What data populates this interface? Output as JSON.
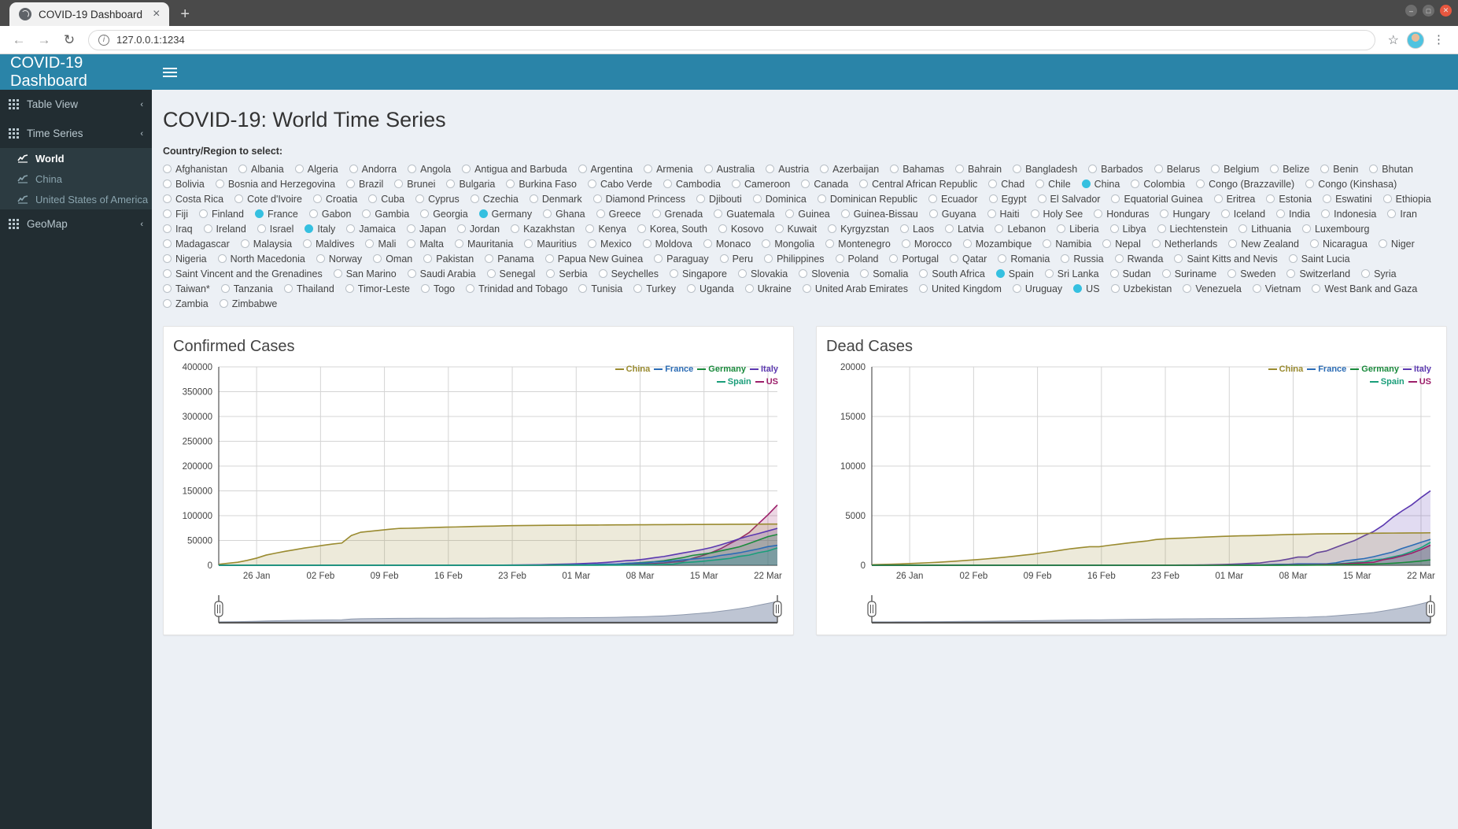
{
  "browser": {
    "tab_title": "COVID-19 Dashboard",
    "tab_close": "×",
    "new_tab": "+",
    "back": "←",
    "forward": "→",
    "reload": "↻",
    "info_icon": "i",
    "url": "127.0.0.1:1234",
    "star": "☆",
    "kebab": "⋮",
    "minimize": "–",
    "maximize": "□",
    "close": "✕"
  },
  "sidebar": {
    "brand": "COVID-19 Dashboard",
    "items": [
      {
        "label": "Table View",
        "chevron": "‹"
      },
      {
        "label": "Time Series",
        "chevron": "‹"
      }
    ],
    "sub_items": [
      {
        "label": "World",
        "active": true
      },
      {
        "label": "China",
        "active": false
      },
      {
        "label": "United States of America",
        "active": false
      }
    ],
    "geomap": {
      "label": "GeoMap",
      "chevron": "‹"
    }
  },
  "main": {
    "page_title": "COVID-19: World Time Series",
    "select_label": "Country/Region to select:",
    "selected_countries": [
      "China",
      "France",
      "Germany",
      "Italy",
      "Spain",
      "US"
    ],
    "countries": [
      "Afghanistan",
      "Albania",
      "Algeria",
      "Andorra",
      "Angola",
      "Antigua and Barbuda",
      "Argentina",
      "Armenia",
      "Australia",
      "Austria",
      "Azerbaijan",
      "Bahamas",
      "Bahrain",
      "Bangladesh",
      "Barbados",
      "Belarus",
      "Belgium",
      "Belize",
      "Benin",
      "Bhutan",
      "Bolivia",
      "Bosnia and Herzegovina",
      "Brazil",
      "Brunei",
      "Bulgaria",
      "Burkina Faso",
      "Cabo Verde",
      "Cambodia",
      "Cameroon",
      "Canada",
      "Central African Republic",
      "Chad",
      "Chile",
      "China",
      "Colombia",
      "Congo (Brazzaville)",
      "Congo (Kinshasa)",
      "Costa Rica",
      "Cote d'Ivoire",
      "Croatia",
      "Cuba",
      "Cyprus",
      "Czechia",
      "Denmark",
      "Diamond Princess",
      "Djibouti",
      "Dominica",
      "Dominican Republic",
      "Ecuador",
      "Egypt",
      "El Salvador",
      "Equatorial Guinea",
      "Eritrea",
      "Estonia",
      "Eswatini",
      "Ethiopia",
      "Fiji",
      "Finland",
      "France",
      "Gabon",
      "Gambia",
      "Georgia",
      "Germany",
      "Ghana",
      "Greece",
      "Grenada",
      "Guatemala",
      "Guinea",
      "Guinea-Bissau",
      "Guyana",
      "Haiti",
      "Holy See",
      "Honduras",
      "Hungary",
      "Iceland",
      "India",
      "Indonesia",
      "Iran",
      "Iraq",
      "Ireland",
      "Israel",
      "Italy",
      "Jamaica",
      "Japan",
      "Jordan",
      "Kazakhstan",
      "Kenya",
      "Korea, South",
      "Kosovo",
      "Kuwait",
      "Kyrgyzstan",
      "Laos",
      "Latvia",
      "Lebanon",
      "Liberia",
      "Libya",
      "Liechtenstein",
      "Lithuania",
      "Luxembourg",
      "Madagascar",
      "Malaysia",
      "Maldives",
      "Mali",
      "Malta",
      "Mauritania",
      "Mauritius",
      "Mexico",
      "Moldova",
      "Monaco",
      "Mongolia",
      "Montenegro",
      "Morocco",
      "Mozambique",
      "Namibia",
      "Nepal",
      "Netherlands",
      "New Zealand",
      "Nicaragua",
      "Niger",
      "Nigeria",
      "North Macedonia",
      "Norway",
      "Oman",
      "Pakistan",
      "Panama",
      "Papua New Guinea",
      "Paraguay",
      "Peru",
      "Philippines",
      "Poland",
      "Portugal",
      "Qatar",
      "Romania",
      "Russia",
      "Rwanda",
      "Saint Kitts and Nevis",
      "Saint Lucia",
      "Saint Vincent and the Grenadines",
      "San Marino",
      "Saudi Arabia",
      "Senegal",
      "Serbia",
      "Seychelles",
      "Singapore",
      "Slovakia",
      "Slovenia",
      "Somalia",
      "South Africa",
      "Spain",
      "Sri Lanka",
      "Sudan",
      "Suriname",
      "Sweden",
      "Switzerland",
      "Syria",
      "Taiwan*",
      "Tanzania",
      "Thailand",
      "Timor-Leste",
      "Togo",
      "Trinidad and Tobago",
      "Tunisia",
      "Turkey",
      "Uganda",
      "Ukraine",
      "United Arab Emirates",
      "United Kingdom",
      "Uruguay",
      "US",
      "Uzbekistan",
      "Venezuela",
      "Vietnam",
      "West Bank and Gaza",
      "Zambia",
      "Zimbabwe"
    ]
  },
  "chart_data": [
    {
      "type": "area",
      "title": "Confirmed Cases",
      "xlabel": "",
      "ylabel": "",
      "ylim": [
        0,
        400000
      ],
      "yticks": [
        0,
        50000,
        100000,
        150000,
        200000,
        250000,
        300000,
        350000,
        400000
      ],
      "xticks": [
        "26 Jan",
        "02 Feb",
        "09 Feb",
        "16 Feb",
        "23 Feb",
        "01 Mar",
        "08 Mar",
        "15 Mar",
        "22 Mar"
      ],
      "grid": true,
      "legend_position": "top-right",
      "series": [
        {
          "name": "China",
          "color": "#9a8b30",
          "values": [
            2000,
            4000,
            6000,
            9800,
            14400,
            20500,
            24400,
            28100,
            31200,
            34600,
            37300,
            40200,
            42700,
            44800,
            59900,
            66600,
            68600,
            70600,
            72500,
            74200,
            74600,
            75100,
            75700,
            76300,
            76900,
            77200,
            77700,
            78200,
            78600,
            78900,
            79400,
            79900,
            80100,
            80300,
            80400,
            80600,
            80700,
            80800,
            80900,
            81000,
            81100,
            81300,
            81400,
            81500,
            81600,
            81700,
            81800,
            81900,
            82000,
            82100,
            82200,
            82300,
            82400,
            82500,
            82600,
            82700,
            82800,
            82900,
            83000,
            83100
          ]
        },
        {
          "name": "France",
          "color": "#2b6cb5",
          "values": [
            3,
            4,
            5,
            5,
            6,
            6,
            6,
            6,
            11,
            11,
            11,
            11,
            11,
            11,
            11,
            11,
            11,
            11,
            12,
            12,
            12,
            12,
            12,
            12,
            12,
            12,
            14,
            18,
            38,
            57,
            100,
            130,
            191,
            212,
            285,
            377,
            653,
            949,
            1126,
            1209,
            1784,
            2281,
            2281,
            3661,
            4469,
            4499,
            6633,
            7652,
            9043,
            10871,
            12612,
            14282,
            16018,
            19856,
            22304,
            25233,
            29155,
            32964,
            37575,
            40174
          ]
        },
        {
          "name": "Germany",
          "color": "#1a8a3c",
          "values": [
            0,
            0,
            0,
            0,
            4,
            4,
            4,
            5,
            8,
            10,
            12,
            12,
            12,
            13,
            13,
            14,
            14,
            16,
            16,
            16,
            16,
            16,
            16,
            16,
            16,
            16,
            17,
            27,
            46,
            48,
            79,
            130,
            159,
            196,
            262,
            482,
            670,
            799,
            1040,
            1176,
            1457,
            1908,
            2078,
            3675,
            4585,
            5795,
            7272,
            9257,
            12327,
            15320,
            19848,
            22213,
            24873,
            29056,
            32986,
            37323,
            43938,
            50871,
            57695,
            62095
          ]
        },
        {
          "name": "Italy",
          "color": "#5b38b0",
          "values": [
            0,
            0,
            0,
            0,
            0,
            0,
            0,
            2,
            2,
            2,
            2,
            2,
            3,
            3,
            3,
            3,
            3,
            3,
            3,
            3,
            3,
            3,
            3,
            3,
            3,
            3,
            20,
            62,
            155,
            229,
            322,
            453,
            655,
            888,
            1128,
            1694,
            2036,
            2502,
            3089,
            3858,
            4636,
            5883,
            7375,
            9172,
            10149,
            12462,
            15113,
            17660,
            21157,
            24747,
            27980,
            31506,
            35713,
            41035,
            47021,
            53578,
            59138,
            63927,
            69176,
            74386
          ]
        },
        {
          "name": "Spain",
          "color": "#1a9e7a",
          "values": [
            0,
            0,
            0,
            0,
            0,
            0,
            0,
            0,
            0,
            1,
            1,
            1,
            1,
            1,
            1,
            1,
            1,
            1,
            2,
            2,
            2,
            2,
            2,
            2,
            2,
            2,
            2,
            2,
            2,
            2,
            2,
            2,
            3,
            5,
            10,
            25,
            32,
            45,
            84,
            120,
            165,
            222,
            259,
            400,
            500,
            673,
            1073,
            1695,
            2277,
            5232,
            6391,
            7798,
            9942,
            11748,
            13910,
            17963,
            20410,
            25374,
            28768,
            35136
          ]
        },
        {
          "name": "US",
          "color": "#9c1f6a",
          "values": [
            1,
            1,
            2,
            2,
            5,
            5,
            5,
            5,
            5,
            7,
            8,
            8,
            11,
            11,
            11,
            11,
            12,
            12,
            12,
            12,
            13,
            13,
            13,
            13,
            15,
            15,
            15,
            35,
            53,
            59,
            60,
            68,
            74,
            98,
            118,
            149,
            217,
            262,
            402,
            518,
            583,
            959,
            1281,
            1663,
            2179,
            2727,
            3499,
            4632,
            6421,
            7783,
            13677,
            19100,
            25489,
            33276,
            43847,
            53740,
            65778,
            83836,
            101657,
            121478
          ]
        }
      ]
    },
    {
      "type": "area",
      "title": "Dead Cases",
      "xlabel": "",
      "ylabel": "",
      "ylim": [
        0,
        20000
      ],
      "yticks": [
        0,
        5000,
        10000,
        15000,
        20000
      ],
      "xticks": [
        "26 Jan",
        "02 Feb",
        "09 Feb",
        "16 Feb",
        "23 Feb",
        "01 Mar",
        "08 Mar",
        "15 Mar",
        "22 Mar"
      ],
      "grid": true,
      "legend_position": "top-right",
      "series": [
        {
          "name": "China",
          "color": "#9a8b30",
          "values": [
            56,
            81,
            106,
            132,
            170,
            213,
            259,
            304,
            361,
            425,
            490,
            563,
            636,
            722,
            811,
            908,
            1016,
            1113,
            1259,
            1380,
            1523,
            1665,
            1770,
            1868,
            1868,
            2004,
            2118,
            2236,
            2345,
            2442,
            2592,
            2663,
            2715,
            2744,
            2788,
            2835,
            2870,
            2912,
            2945,
            2968,
            2981,
            3012,
            3042,
            3070,
            3097,
            3119,
            3136,
            3158,
            3169,
            3176,
            3189,
            3199,
            3213,
            3226,
            3237,
            3245,
            3248,
            3255,
            3261,
            3274
          ]
        },
        {
          "name": "France",
          "color": "#2b6cb5",
          "values": [
            0,
            0,
            0,
            0,
            0,
            0,
            0,
            0,
            0,
            0,
            0,
            0,
            0,
            0,
            0,
            0,
            0,
            0,
            1,
            1,
            1,
            1,
            1,
            1,
            1,
            1,
            1,
            2,
            2,
            2,
            2,
            2,
            3,
            4,
            6,
            9,
            11,
            19,
            19,
            33,
            48,
            48,
            79,
            91,
            91,
            148,
            148,
            148,
            148,
            244,
            451,
            563,
            676,
            862,
            1100,
            1331,
            1696,
            1995,
            2314,
            2606
          ]
        },
        {
          "name": "Germany",
          "color": "#1a8a3c",
          "values": [
            0,
            0,
            0,
            0,
            0,
            0,
            0,
            0,
            0,
            0,
            0,
            0,
            0,
            0,
            0,
            0,
            0,
            0,
            0,
            0,
            0,
            0,
            0,
            0,
            0,
            0,
            0,
            0,
            0,
            0,
            0,
            0,
            0,
            0,
            0,
            0,
            0,
            0,
            2,
            2,
            2,
            3,
            3,
            7,
            9,
            11,
            17,
            24,
            28,
            44,
            67,
            84,
            94,
            123,
            159,
            206,
            267,
            342,
            433,
            545
          ]
        },
        {
          "name": "Italy",
          "color": "#5b38b0",
          "values": [
            0,
            0,
            0,
            0,
            0,
            0,
            0,
            0,
            0,
            0,
            0,
            0,
            0,
            0,
            0,
            0,
            0,
            0,
            0,
            0,
            0,
            0,
            0,
            0,
            0,
            0,
            1,
            2,
            3,
            7,
            10,
            12,
            17,
            21,
            29,
            34,
            52,
            79,
            107,
            148,
            197,
            233,
            366,
            463,
            631,
            827,
            827,
            1266,
            1441,
            1809,
            2158,
            2503,
            2978,
            3405,
            4032,
            4825,
            5476,
            6077,
            6820,
            7503
          ]
        },
        {
          "name": "Spain",
          "color": "#1a9e7a",
          "values": [
            0,
            0,
            0,
            0,
            0,
            0,
            0,
            0,
            0,
            0,
            0,
            0,
            0,
            0,
            0,
            0,
            0,
            0,
            0,
            0,
            0,
            0,
            0,
            0,
            0,
            0,
            0,
            0,
            0,
            0,
            0,
            0,
            0,
            0,
            0,
            0,
            0,
            0,
            0,
            0,
            1,
            2,
            3,
            5,
            10,
            17,
            28,
            35,
            54,
            133,
            195,
            289,
            342,
            533,
            623,
            830,
            1043,
            1375,
            1772,
            2311
          ]
        },
        {
          "name": "US",
          "color": "#9c1f6a",
          "values": [
            0,
            0,
            0,
            0,
            0,
            0,
            0,
            0,
            0,
            0,
            0,
            0,
            0,
            0,
            0,
            0,
            0,
            0,
            0,
            0,
            0,
            0,
            0,
            0,
            0,
            0,
            0,
            0,
            0,
            0,
            0,
            1,
            1,
            1,
            6,
            7,
            11,
            12,
            14,
            17,
            21,
            22,
            26,
            30,
            38,
            41,
            48,
            58,
            71,
            95,
            150,
            206,
            256,
            301,
            557,
            706,
            942,
            1209,
            1581,
            2026
          ]
        }
      ]
    }
  ]
}
